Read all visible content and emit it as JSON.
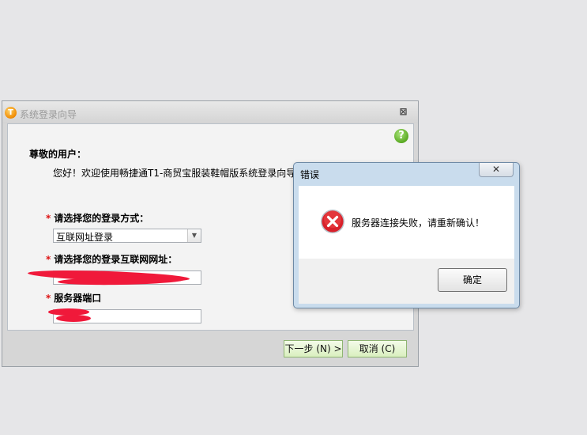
{
  "wizard": {
    "title": "系统登录向导",
    "app_icon_glyph": "T",
    "close_glyph": "⊠",
    "help_glyph": "?",
    "greeting": "尊敬的用户：",
    "welcome_text": "您好！欢迎使用畅捷通T1-商贸宝服装鞋帽版系统登录向导",
    "required_mark": "*",
    "login_method_label": "请选择您的登录方式：",
    "login_method_value": "互联网址登录",
    "select_arrow_glyph": "▼",
    "url_label": "请选择您的登录互联网网址：",
    "url_value": "",
    "port_label": "服务器端口",
    "port_value": "",
    "next_button": "下一步 (N) >",
    "cancel_button": "取消 (C)"
  },
  "error_dialog": {
    "title": "错误",
    "close_glyph": "✕",
    "message": "服务器连接失败，请重新确认！",
    "ok_button": "确定",
    "icon": "error-x-icon"
  },
  "colors": {
    "background": "#e6e6e8",
    "redaction": "#f0193a",
    "required": "#dd1111",
    "button_green": "#d9efbf",
    "dialog_frame": "#c9dced",
    "error_red": "#d8202a"
  }
}
